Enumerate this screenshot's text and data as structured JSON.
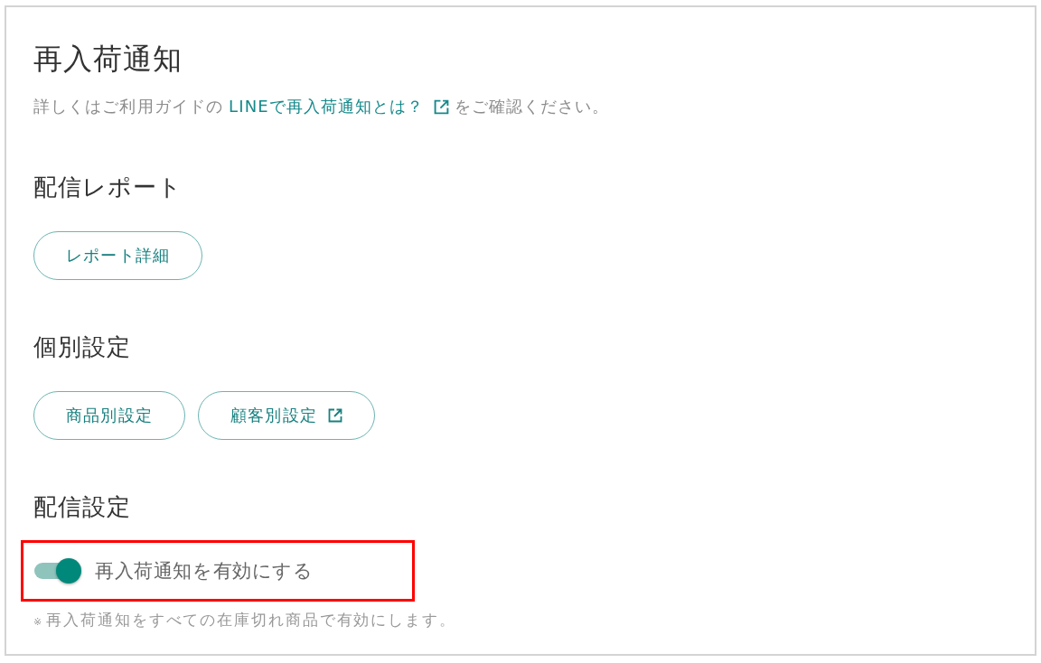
{
  "page": {
    "title": "再入荷通知",
    "intro": {
      "before": "詳しくはご利用ガイドの",
      "link": "LINEで再入荷通知とは？",
      "link_external": true,
      "after": "をご確認ください。"
    }
  },
  "sections": [
    {
      "heading": "配信レポート",
      "kind": "buttons",
      "buttons": [
        {
          "label": "レポート詳細",
          "external": false
        }
      ]
    },
    {
      "heading": "個別設定",
      "kind": "buttons",
      "buttons": [
        {
          "label": "商品別設定",
          "external": false
        },
        {
          "label": "顧客別設定",
          "external": true
        }
      ]
    },
    {
      "heading": "配信設定",
      "kind": "toggle",
      "toggle": {
        "label": "再入荷通知を有効にする",
        "on": true,
        "highlighted": true
      },
      "note": {
        "mark": "※",
        "text": "再入荷通知をすべての在庫切れ商品で有効にします。"
      }
    }
  ]
}
